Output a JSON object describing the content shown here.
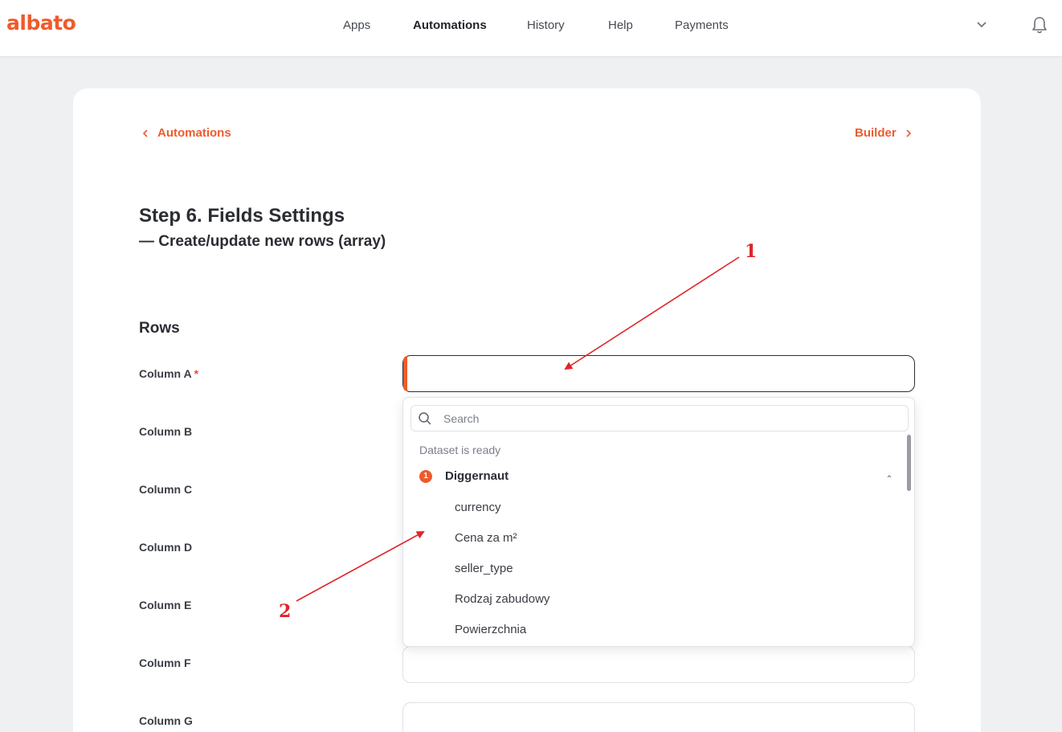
{
  "brand": {
    "logo_text": "albato",
    "accent_color": "#f05a2a"
  },
  "nav": {
    "items": [
      {
        "label": "Apps",
        "active": false
      },
      {
        "label": "Automations",
        "active": true
      },
      {
        "label": "History",
        "active": false
      },
      {
        "label": "Help",
        "active": false
      },
      {
        "label": "Payments",
        "active": false
      }
    ],
    "dropdown_icon": "chevron-down-icon",
    "notifications_icon": "bell-icon"
  },
  "breadcrumb": {
    "back_label": "Automations",
    "forward_label": "Builder"
  },
  "step": {
    "title": "Step 6. Fields Settings",
    "subtitle": "— Create/update new rows (array)"
  },
  "section": {
    "title": "Rows"
  },
  "columns": [
    {
      "label": "Column A",
      "required": "*",
      "value": ""
    },
    {
      "label": "Column B",
      "value": ""
    },
    {
      "label": "Column C",
      "value": ""
    },
    {
      "label": "Column D",
      "value": ""
    },
    {
      "label": "Column E",
      "value": ""
    },
    {
      "label": "Column F",
      "value": ""
    },
    {
      "label": "Column G",
      "value": ""
    }
  ],
  "dropdown": {
    "search_placeholder": "Search",
    "group_caption": "Dataset is ready",
    "group": {
      "badge": "1",
      "name": "Diggernaut"
    },
    "options": [
      "currency",
      "Cena za m²",
      "seller_type",
      "Rodzaj zabudowy",
      "Powierzchnia"
    ]
  },
  "annotations": {
    "first": "1",
    "second": "2",
    "color": "#e0242a"
  }
}
